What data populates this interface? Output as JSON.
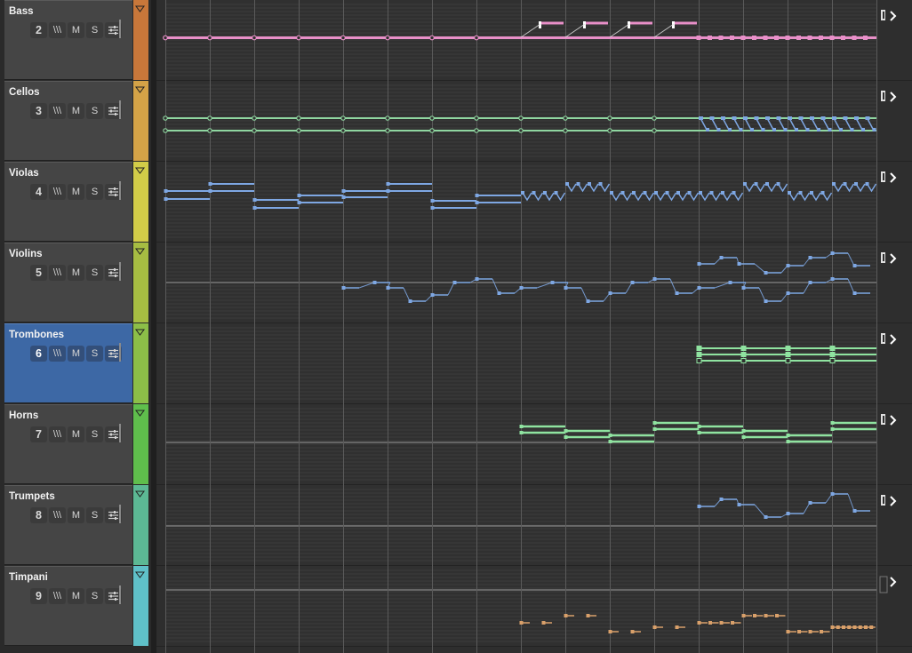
{
  "tracks": [
    {
      "name": "Bass",
      "number": "2",
      "color": "#c8773a",
      "selected": false,
      "noteColor": "#e88fc8"
    },
    {
      "name": "Cellos",
      "number": "3",
      "color": "#d4a347",
      "selected": false,
      "noteColor": "#8fd6a0"
    },
    {
      "name": "Violas",
      "number": "4",
      "color": "#d2cc48",
      "selected": false,
      "noteColor": "#7ea7e3"
    },
    {
      "name": "Violins",
      "number": "5",
      "color": "#a6bd42",
      "selected": false,
      "noteColor": "#7ea7e3"
    },
    {
      "name": "Trombones",
      "number": "6",
      "color": "#8cbe48",
      "selected": true,
      "noteColor": "#8fe3a0"
    },
    {
      "name": "Horns",
      "number": "7",
      "color": "#5fbe4c",
      "selected": false,
      "noteColor": "#8fe3a0"
    },
    {
      "name": "Trumpets",
      "number": "8",
      "color": "#5cb894",
      "selected": false,
      "noteColor": "#7ea7e3"
    },
    {
      "name": "Timpani",
      "number": "9",
      "color": "#5fc0c8",
      "selected": false,
      "noteColor": "#d9a06a"
    }
  ],
  "controls": {
    "input_monitor_label": "\\\\\\",
    "mute_label": "M",
    "solo_label": "S",
    "settings_icon": "sliders-icon",
    "expand_icon": "chevron-right-icon",
    "lane_icon": "lane-bracket-icon",
    "collapse_icon": "triangle-down-icon"
  }
}
